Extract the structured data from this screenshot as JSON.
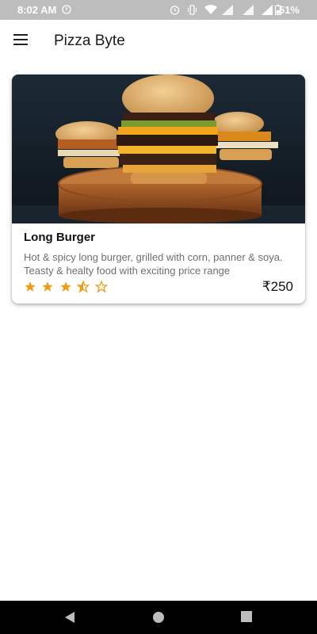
{
  "status_bar": {
    "time": "8:02 AM",
    "battery": "51%",
    "icons": [
      "vpn-icon",
      "alarm-icon",
      "vibrate-icon",
      "wifi-icon",
      "signal-icon",
      "battery-icon"
    ]
  },
  "app_bar": {
    "title": "Pizza Byte",
    "menu_icon": "menu-icon"
  },
  "card": {
    "title": "Long Burger",
    "description": "Hot & spicy long burger, grilled with corn, panner & soya. Teasty & healty food with exciting price range",
    "rating": 3.5,
    "rating_max": 5,
    "price": "₹250",
    "accent_color": "#f39c12"
  },
  "nav_bar": {
    "icons": [
      "back-icon",
      "home-icon",
      "recents-icon"
    ]
  }
}
